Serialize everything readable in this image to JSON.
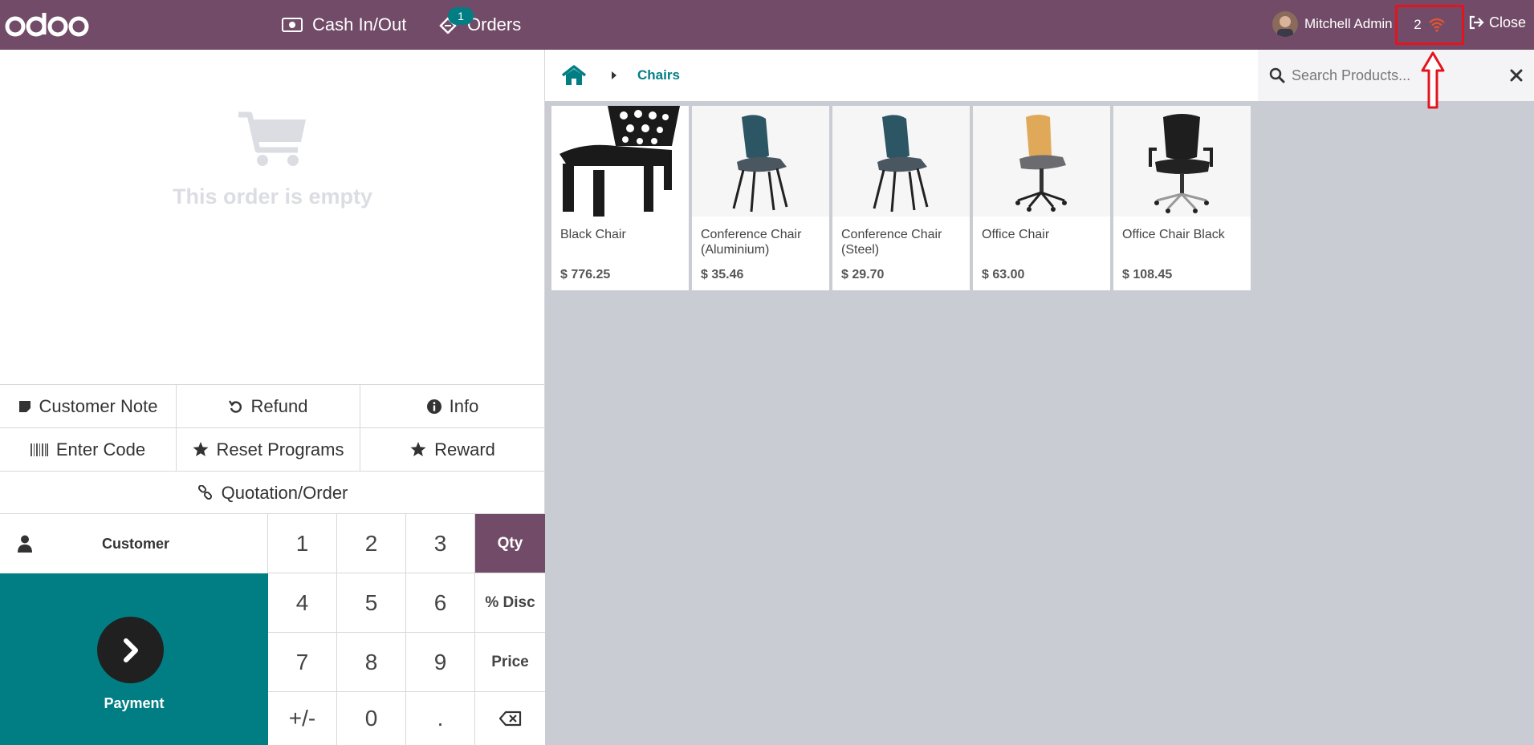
{
  "topbar": {
    "logo": "odoo",
    "cash_label": "Cash In/Out",
    "orders_label": "Orders",
    "orders_count": "1",
    "user_name": "Mitchell Admin",
    "sync_count": "2",
    "close_label": "Close",
    "color": "#714b67"
  },
  "order": {
    "empty_message": "This order is empty"
  },
  "controls": {
    "customer_note": "Customer Note",
    "refund": "Refund",
    "info": "Info",
    "enter_code": "Enter Code",
    "reset_programs": "Reset Programs",
    "reward": "Reward",
    "quotation": "Quotation/Order"
  },
  "numpad": {
    "customer": "Customer",
    "payment": "Payment",
    "keys": [
      "1",
      "2",
      "3",
      "4",
      "5",
      "6",
      "7",
      "8",
      "9",
      "+/-",
      "0",
      "."
    ],
    "modes": [
      "Qty",
      "% Disc",
      "Price"
    ],
    "active_mode": "Qty"
  },
  "breadcrumb": {
    "category": "Chairs"
  },
  "search": {
    "placeholder": "Search Products..."
  },
  "products": [
    {
      "name": "Black Chair",
      "price": "$ 776.25"
    },
    {
      "name": "Conference Chair (Aluminium)",
      "price": "$ 35.46"
    },
    {
      "name": "Conference Chair (Steel)",
      "price": "$ 29.70"
    },
    {
      "name": "Office Chair",
      "price": "$ 63.00"
    },
    {
      "name": "Office Chair Black",
      "price": "$ 108.45"
    }
  ],
  "colors": {
    "primary": "#714b67",
    "accent": "#017e84",
    "highlight": "#e3141d"
  }
}
